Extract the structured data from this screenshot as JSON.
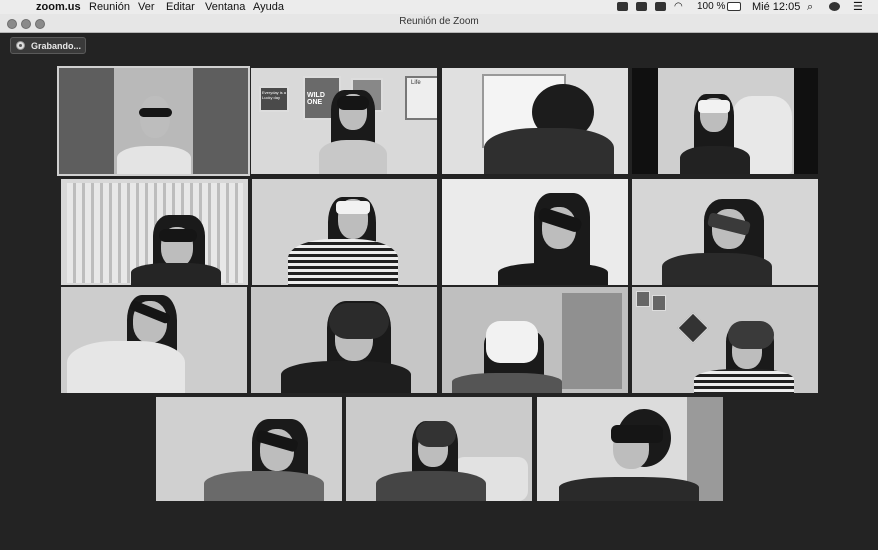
{
  "menubar": {
    "apple_symbol": "",
    "app": "zoom.us",
    "items": [
      "Reunión",
      "Ver",
      "Editar",
      "Ventana",
      "Ayuda"
    ],
    "battery_text": "100 %",
    "clock": "Mié 12:05",
    "status_icons": [
      "camera-icon",
      "airplay-icon",
      "screen-icon",
      "wifi-icon",
      "battery-icon",
      "search-icon",
      "siri-icon",
      "control-center-icon"
    ]
  },
  "window": {
    "title": "Reunión de Zoom",
    "recording_label": "Grabando..."
  },
  "participants": [
    {
      "id": 1,
      "row": 1,
      "active": true,
      "accessory": "sunglasses"
    },
    {
      "id": 2,
      "row": 1,
      "accessory": "sleep-mask"
    },
    {
      "id": 3,
      "row": 1,
      "accessory": "hood"
    },
    {
      "id": 4,
      "row": 1,
      "accessory": "white-blindfold"
    },
    {
      "id": 5,
      "row": 2,
      "accessory": "sleep-mask"
    },
    {
      "id": 6,
      "row": 2,
      "accessory": "white-blindfold"
    },
    {
      "id": 7,
      "row": 2,
      "accessory": "blindfold"
    },
    {
      "id": 8,
      "row": 2,
      "accessory": "patterned-blindfold"
    },
    {
      "id": 9,
      "row": 3,
      "accessory": "blindfold"
    },
    {
      "id": 10,
      "row": 3,
      "accessory": "beanie-over-eyes"
    },
    {
      "id": 11,
      "row": 3,
      "accessory": "white-cloth"
    },
    {
      "id": 12,
      "row": 3,
      "accessory": "beanie-over-eyes"
    },
    {
      "id": 13,
      "row": 4,
      "accessory": "blindfold"
    },
    {
      "id": 14,
      "row": 4,
      "accessory": "beanie-over-eyes"
    },
    {
      "id": 15,
      "row": 4,
      "accessory": "sleep-mask"
    }
  ],
  "posters": {
    "tile2_left": "Everyday is a Lucky day",
    "tile2_center": "WILD ONE",
    "tile2_right": "Life"
  }
}
